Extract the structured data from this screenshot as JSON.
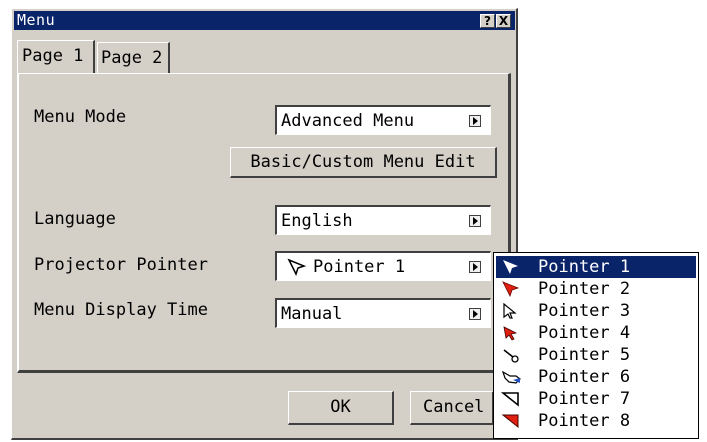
{
  "window": {
    "title": "Menu",
    "help_button": "?",
    "close_button": "X"
  },
  "tabs": [
    {
      "label": "Page 1",
      "active": true
    },
    {
      "label": "Page 2",
      "active": false
    }
  ],
  "settings": {
    "menu_mode": {
      "label": "Menu Mode",
      "value": "Advanced Menu"
    },
    "custom_edit_button": "Basic/Custom Menu Edit",
    "language": {
      "label": "Language",
      "value": "English"
    },
    "projector_pointer": {
      "label": "Projector Pointer",
      "value": "Pointer 1"
    },
    "menu_display_time": {
      "label": "Menu Display Time",
      "value": "Manual"
    }
  },
  "buttons": {
    "ok": "OK",
    "cancel": "Cancel"
  },
  "pointer_options": [
    {
      "label": "Pointer 1",
      "icon": "arrow-pointer-icon",
      "selected": true
    },
    {
      "label": "Pointer 2",
      "icon": "red-arrow-pointer-icon",
      "selected": false
    },
    {
      "label": "Pointer 3",
      "icon": "outline-arrow-pointer-icon",
      "selected": false
    },
    {
      "label": "Pointer 4",
      "icon": "red-small-arrow-pointer-icon",
      "selected": false
    },
    {
      "label": "Pointer 5",
      "icon": "pointing-stick-icon",
      "selected": false
    },
    {
      "label": "Pointer 6",
      "icon": "hand-pointer-icon",
      "selected": false
    },
    {
      "label": "Pointer 7",
      "icon": "wedge-pointer-icon",
      "selected": false
    },
    {
      "label": "Pointer 8",
      "icon": "red-wedge-pointer-icon",
      "selected": false
    }
  ],
  "colors": {
    "titlebar": "#0a246a",
    "face": "#d4d0c8",
    "selection": "#0a246a",
    "pointer_red": "#e02010"
  }
}
